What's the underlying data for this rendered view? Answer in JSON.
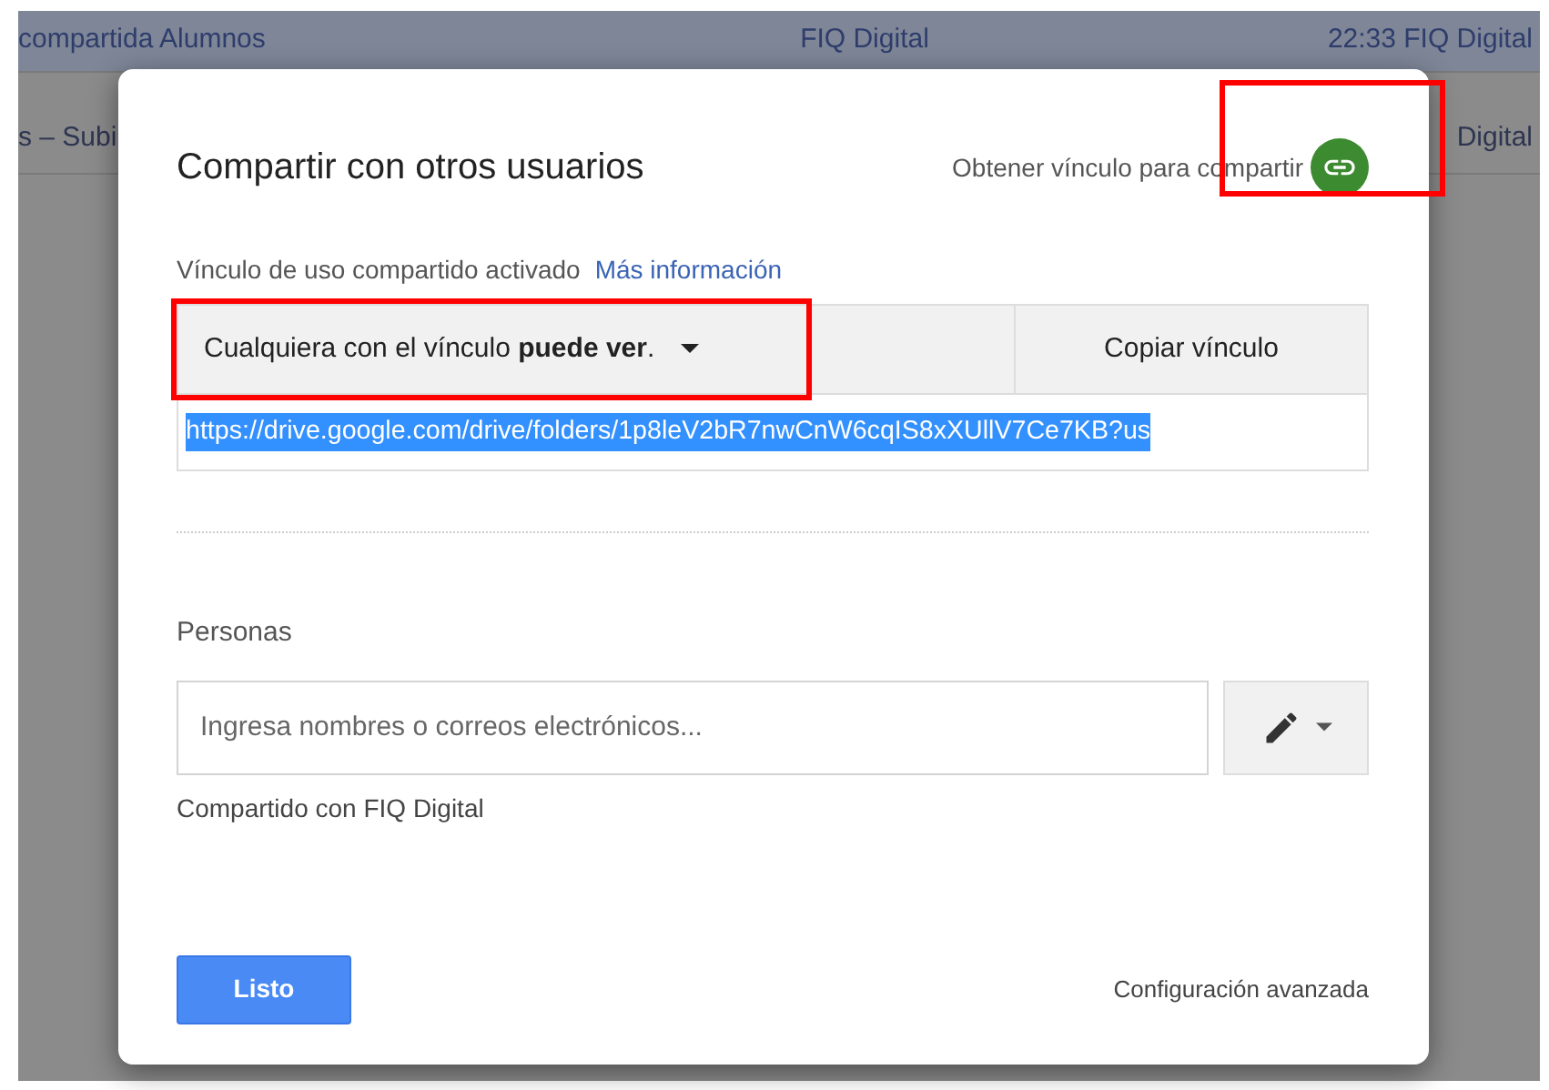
{
  "background_rows": [
    {
      "cells": [
        "compartida Alumnos",
        "FIQ Digital",
        "22:33  FIQ Digital"
      ],
      "selected": true
    },
    {
      "cells": [
        "s – Subi",
        "",
        "Digital"
      ],
      "selected": false
    }
  ],
  "dialog": {
    "title": "Compartir con otros usuarios",
    "get_link": {
      "label": "Obtener vínculo para compartir",
      "on": true,
      "highlighted": true
    },
    "link_status": "Vínculo de uso compartido activado",
    "more_info": "Más información",
    "access_dropdown": {
      "label": "Cualquiera con el vínculo **puede ver**.",
      "highlighted": true
    },
    "copy_button": "Copiar vínculo",
    "link_url": {
      "value": "https://drive.google.com/drive/folders/1p8leV2bR7nwCnW6cqIS8xXUllV7Ce7KB?us",
      "selected": true
    },
    "people_label": "Personas",
    "people_field": {
      "placeholder": "Ingresa nombres o correos electrónicos..."
    },
    "shared_with": "Compartido con FIQ Digital",
    "done_button": "Listo",
    "advanced": "Configuración avanzada"
  }
}
